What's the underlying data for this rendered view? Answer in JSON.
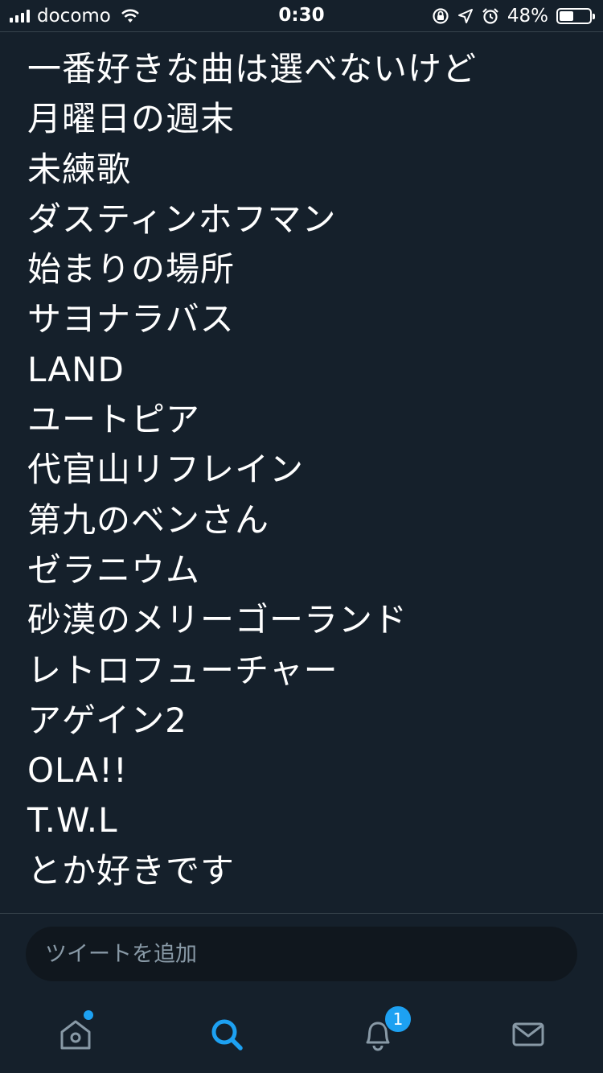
{
  "status_bar": {
    "carrier": "docomo",
    "time": "0:30",
    "battery_percent": "48%",
    "battery_level": 0.48,
    "icons": [
      "signal-icon",
      "wifi-icon",
      "orientation-lock-icon",
      "location-icon",
      "alarm-icon",
      "battery-icon"
    ]
  },
  "tweet": {
    "lines": [
      "一番好きな曲は選べないけど",
      "月曜日の週末",
      "未練歌",
      "ダスティンホフマン",
      "始まりの場所",
      "サヨナラバス",
      "LAND",
      "ユートピア",
      "代官山リフレイン",
      "第九のベンさん",
      "ゼラニウム",
      "砂漠のメリーゴーランド",
      "レトロフューチャー",
      "アゲイン2",
      "OLA!!",
      "T.W.L",
      "とか好きです"
    ]
  },
  "reply": {
    "placeholder": "ツイートを追加",
    "value": ""
  },
  "tab_bar": {
    "tabs": [
      "home-icon",
      "search-icon",
      "notifications-icon",
      "messages-icon"
    ],
    "active_tab": "search",
    "notification_count": "1",
    "accent_color": "#1da1f2"
  },
  "colors": {
    "background": "#15202b",
    "text": "#ffffff",
    "placeholder": "#8899a6",
    "accent": "#1da1f2",
    "divider": "#38444d"
  }
}
